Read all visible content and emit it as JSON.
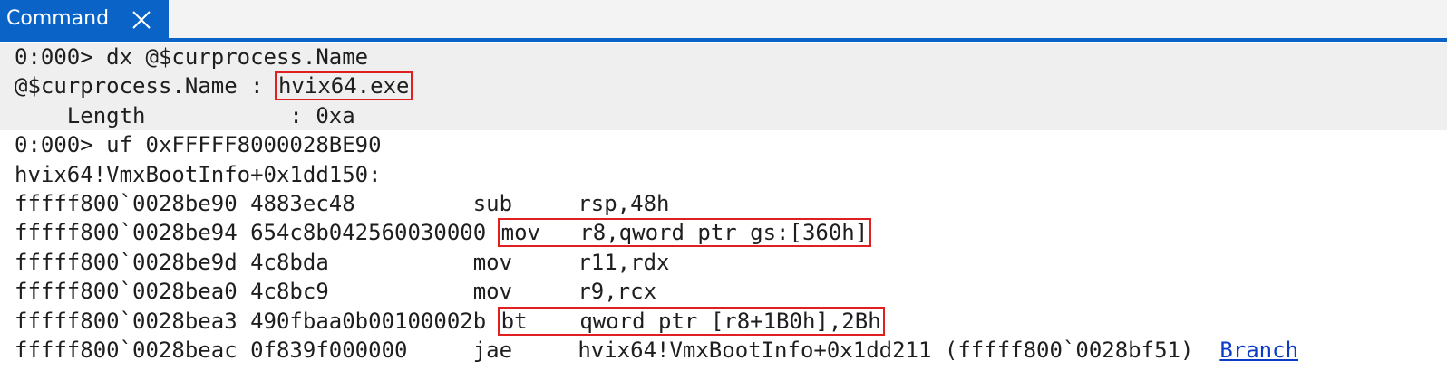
{
  "tab": {
    "label": "Command",
    "close_icon": "close-icon"
  },
  "colors": {
    "accent": "#0a64c8",
    "highlight_bg": "#efefef",
    "box_outline": "#e02020",
    "link": "#0a3cc8"
  },
  "lines": [
    {
      "text": "0:000> dx @$curprocess.Name"
    },
    {
      "prefix": "@$curprocess.Name : ",
      "boxed": "hvix64.exe"
    },
    {
      "text": "    Length           : 0xa"
    },
    {
      "text": "0:000> uf 0xFFFFF8000028BE90"
    },
    {
      "text": "hvix64!VmxBootInfo+0x1dd150:"
    },
    {
      "text": "fffff800`0028be90 4883ec48         sub     rsp,48h"
    },
    {
      "prefix": "fffff800`0028be94 654c8b042560030000 ",
      "boxed": "mov   r8,qword ptr gs:[360h]"
    },
    {
      "text": "fffff800`0028be9d 4c8bda           mov     r11,rdx"
    },
    {
      "text": "fffff800`0028bea0 4c8bc9           mov     r9,rcx"
    },
    {
      "prefix": "fffff800`0028bea3 490fbaa0b00100002b ",
      "boxed": "bt    qword ptr [r8+1B0h],2Bh"
    },
    {
      "prefix": "fffff800`0028beac 0f839f000000     jae     hvix64!VmxBootInfo+0x1dd211 (fffff800`0028bf51)  ",
      "link": "Branch"
    }
  ]
}
